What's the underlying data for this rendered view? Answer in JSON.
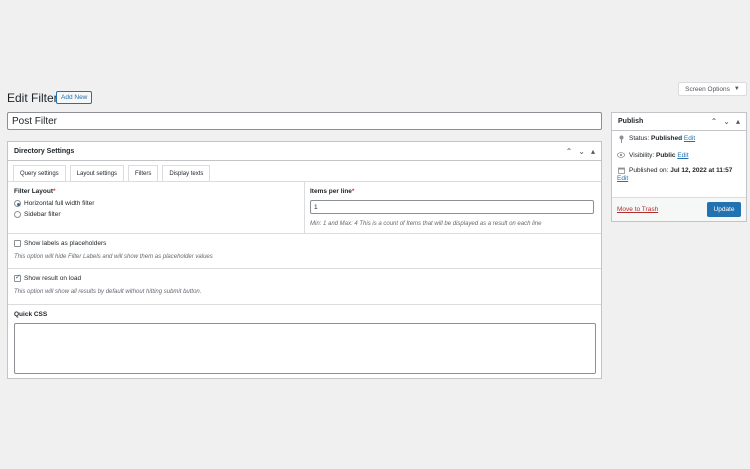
{
  "screen_options": {
    "label": "Screen Options",
    "caret": "▼"
  },
  "page": {
    "title": "Edit Filter",
    "add_new": "Add New",
    "post_title": "Post Filter"
  },
  "directory_settings": {
    "title": "Directory Settings",
    "controls": [
      "⌃",
      "⌄",
      "▴"
    ],
    "tabs": [
      "Query settings",
      "Layout settings",
      "Filters",
      "Display texts"
    ],
    "filter_layout": {
      "label": "Filter Layout",
      "required": "*",
      "options": [
        "Horizontal full width filter",
        "Sidebar filter"
      ],
      "selected": 0
    },
    "items_per_line": {
      "label": "Items per line",
      "required": "*",
      "value": "1",
      "hint": "Min: 1 and Max: 4 This is a count of Items that will be displayed as a result on each line"
    },
    "show_labels": {
      "label": "Show labels as placeholders",
      "checked": false,
      "hint": "This option will hide Filter Labels and will show them as placeholder values"
    },
    "show_result": {
      "label": "Show result on load",
      "checked": true,
      "hint": "This option will show all results by default without hitting submit button."
    },
    "quick_css": {
      "label": "Quick CSS",
      "value": ""
    }
  },
  "publish": {
    "title": "Publish",
    "controls": [
      "⌃",
      "⌄",
      "▴"
    ],
    "status_label": "Status:",
    "status_value": "Published",
    "visibility_label": "Visibility:",
    "visibility_value": "Public",
    "published_label": "Published on:",
    "published_value": "Jul 12, 2022 at 11:57",
    "edit": "Edit",
    "trash": "Move to Trash",
    "update": "Update"
  }
}
